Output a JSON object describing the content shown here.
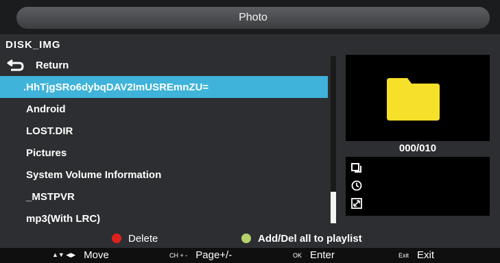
{
  "header": {
    "title": "Photo"
  },
  "location": {
    "label": "DISK_IMG"
  },
  "list": {
    "return_label": "Return",
    "items": [
      ".HhTjgSRo6dybqDAV2ImUSREmnZU=",
      "Android",
      "LOST.DIR",
      "Pictures",
      "System Volume Information",
      "_MSTPVR",
      "mp3(With LRC)"
    ],
    "selected_index": 0
  },
  "preview": {
    "counter": "000/010",
    "folder_color": "#f7e02a"
  },
  "hints": {
    "delete_label": "Delete",
    "delete_color": "#e0201e",
    "playlist_label": "Add/Del all to playlist",
    "playlist_color": "#b4d46b"
  },
  "nav": {
    "move_key": "▲▼ ◀▶",
    "move_label": "Move",
    "page_key": "CH + -",
    "page_label": "Page+/-",
    "ok_key": "OK",
    "ok_label": "Enter",
    "exit_key": "Exit",
    "exit_label": "Exit"
  }
}
